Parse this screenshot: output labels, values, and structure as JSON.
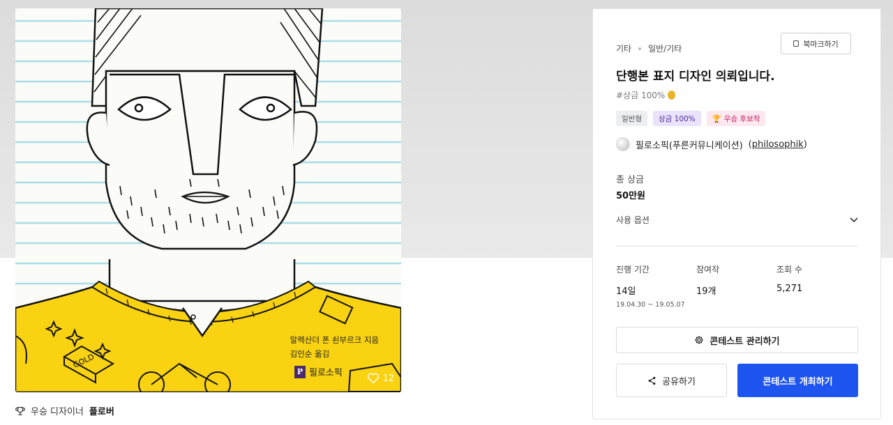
{
  "artwork": {
    "author_line": "알렉산더 폰 쇤부르크 지음",
    "translator_line": "김인순 옮김",
    "publisher_name": "필로소픽",
    "publisher_mark": "P",
    "likes": "12",
    "sweater_color": "#f9d212",
    "lines_color": "#a9dde6"
  },
  "winner": {
    "label": "우승 디자이너",
    "name": "플로버"
  },
  "panel": {
    "breadcrumb": [
      "기타",
      "일반/기타"
    ],
    "bookmark_label": "북마크하기",
    "title": "단행본 표지 디자인 의뢰입니다.",
    "prize_tag": "#상금 100%",
    "badges": [
      "일반형",
      "상금 100%",
      "우승 후보작"
    ],
    "holder_name": "필로소픽(푸른커뮤니케이션)",
    "holder_handle_open": " (",
    "holder_handle": "philosophik",
    "holder_handle_close": ")",
    "total_prize_label": "총 상금",
    "total_prize_value": "50만원",
    "usage_options_label": "사용 옵션",
    "stats": [
      {
        "label": "진행 기간",
        "value": "14일",
        "dates": "19.04.30 ~ 19.05.07"
      },
      {
        "label": "참여작",
        "value": "19개"
      },
      {
        "label": "조회 수",
        "value": "5,271"
      }
    ],
    "manage_label": "콘테스트 관리하기",
    "share_label": "공유하기",
    "host_label": "콘테스트 개최하기",
    "accent_color": "#1e55f0"
  }
}
